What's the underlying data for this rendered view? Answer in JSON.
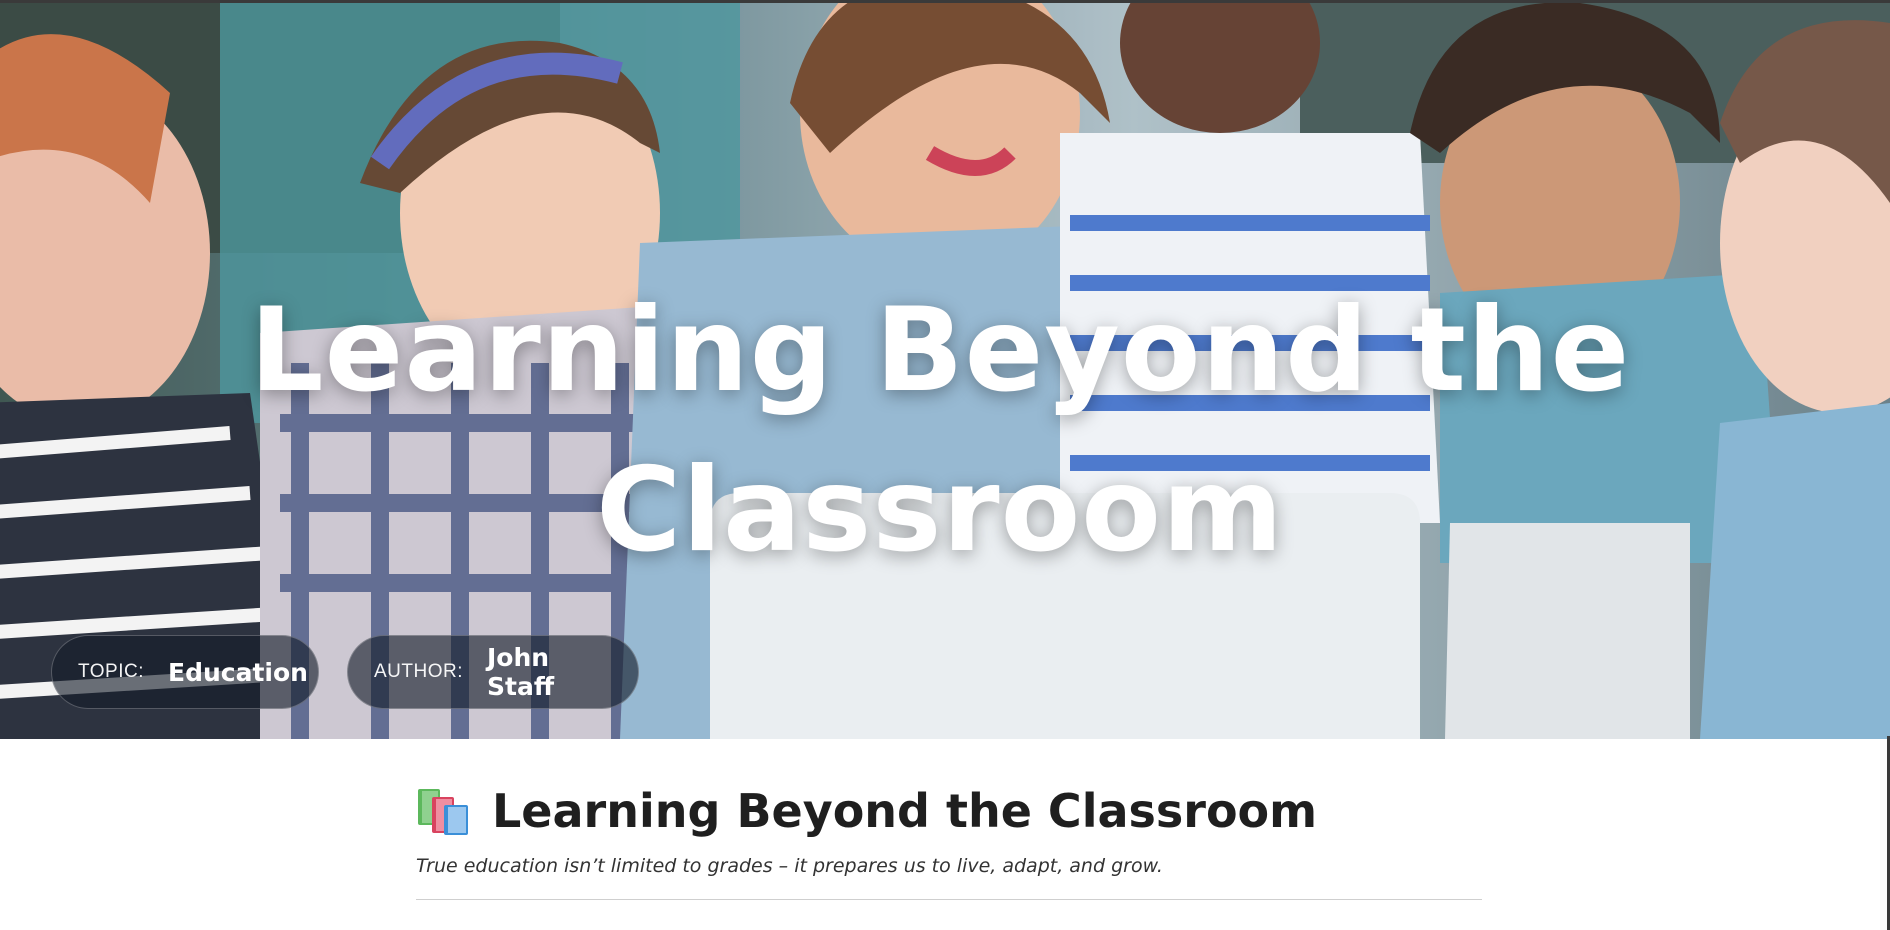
{
  "hero": {
    "title": "Learning Beyond the Classroom",
    "topic_label": "TOPIC:",
    "topic_value": "Education",
    "author_label": "AUTHOR:",
    "author_value": "John Staff"
  },
  "article": {
    "title": "Learning Beyond the Classroom",
    "subtitle": "True education isn’t limited to grades – it prepares us to live, adapt, and grow.",
    "title_icon": "books-icon"
  },
  "colors": {
    "title_text": "#1f1f1f",
    "hero_text": "#ffffff",
    "pill_bg": "#141c28"
  }
}
